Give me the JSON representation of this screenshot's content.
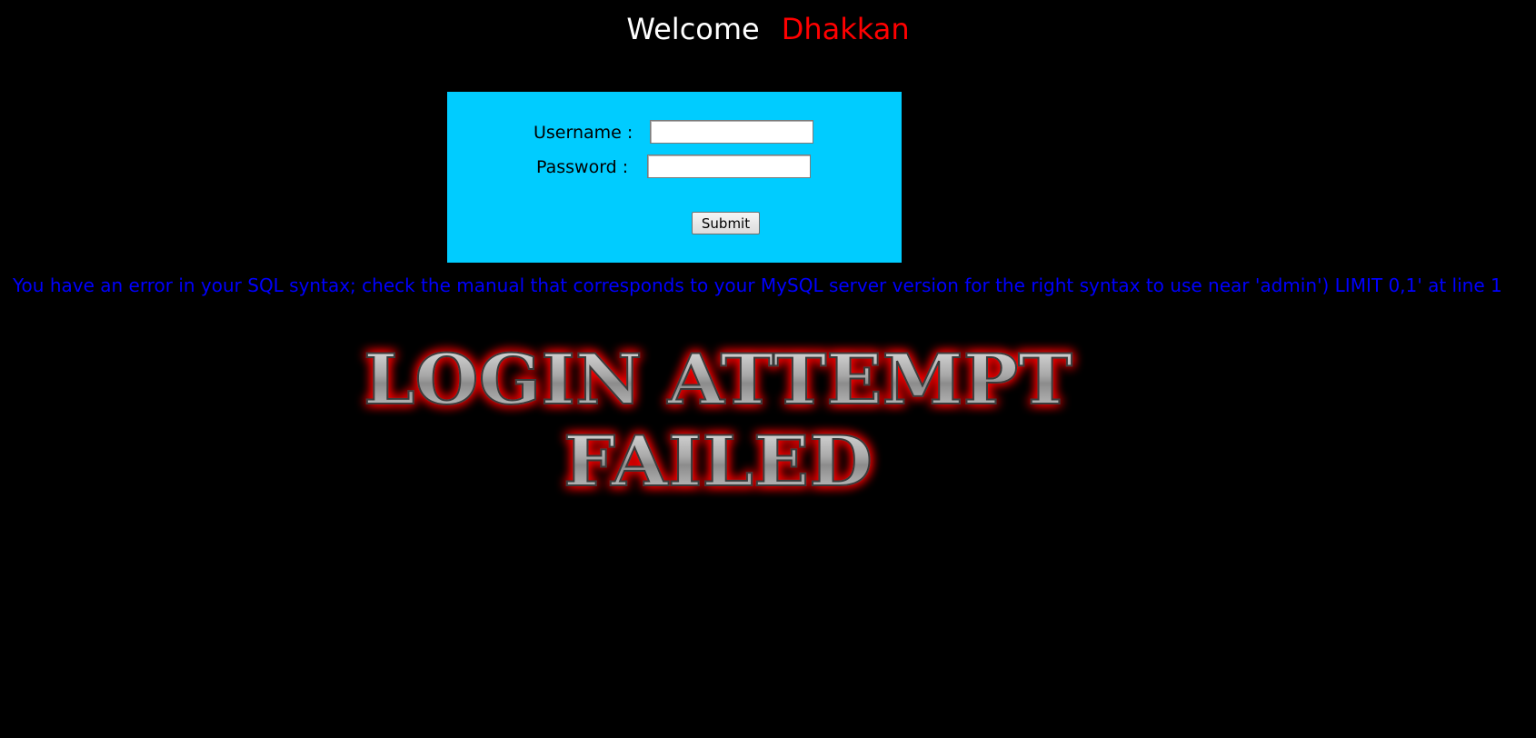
{
  "header": {
    "welcome_word": "Welcome",
    "user_name": "Dhakkan",
    "welcome_color": "#ffffff",
    "name_color": "#ff0000"
  },
  "login_form": {
    "background_color": "#00ccff",
    "username_label": "Username :",
    "username_value": "",
    "password_label": "Password :",
    "password_value": "",
    "submit_label": "Submit"
  },
  "error": {
    "message": "You have an error in your SQL syntax; check the manual that corresponds to your MySQL server version for the right syntax to use near 'admin') LIMIT 0,1' at line 1",
    "color": "#0000ff"
  },
  "banner": {
    "line1": "LOGIN ATTEMPT",
    "line2": "FAILED",
    "glow_color": "#ff0000",
    "metal_color": "#a8a8a8"
  }
}
